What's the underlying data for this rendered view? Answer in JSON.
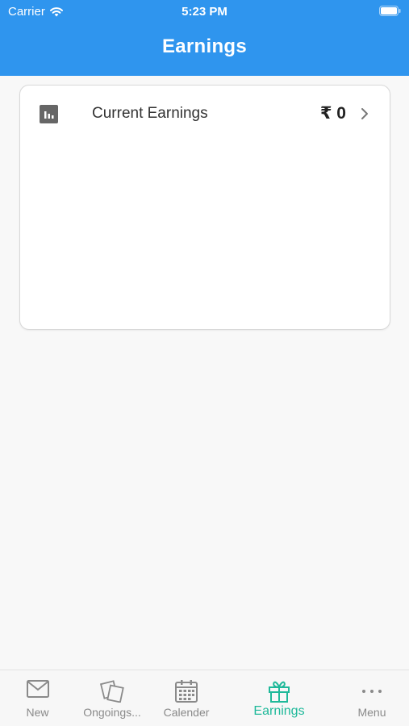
{
  "status_bar": {
    "carrier": "Carrier",
    "time": "5:23 PM"
  },
  "header": {
    "title": "Earnings"
  },
  "card": {
    "label": "Current Earnings",
    "amount": "₹ 0"
  },
  "tabs": [
    {
      "label": "New",
      "icon": "mail-icon"
    },
    {
      "label": "Ongoings...",
      "icon": "cards-icon"
    },
    {
      "label": "Calender",
      "icon": "calendar-icon"
    },
    {
      "label": "Earnings",
      "icon": "gift-icon",
      "active": true
    },
    {
      "label": "Menu",
      "icon": "more-icon"
    }
  ],
  "colors": {
    "header": "#2f95ee",
    "active_tab": "#1fb99a",
    "inactive_tab": "#8a8a8a"
  }
}
